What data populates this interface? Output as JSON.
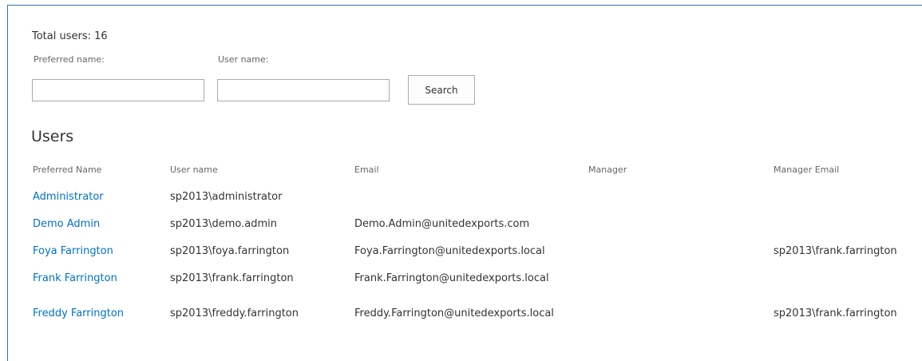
{
  "summary": {
    "total_users": "Total users: 16"
  },
  "filters": {
    "preferred_name_label": "Preferred name:",
    "preferred_name_value": "",
    "user_name_label": "User name:",
    "user_name_value": "",
    "search_label": "Search"
  },
  "section": {
    "title": "Users"
  },
  "table": {
    "columns": [
      "Preferred Name",
      "User name",
      "Email",
      "Manager",
      "Manager Email"
    ],
    "rows": [
      {
        "name": "Administrator",
        "user": "sp2013\\administrator",
        "email": "",
        "manager": "",
        "manager_email": ""
      },
      {
        "name": "Demo Admin",
        "user": "sp2013\\demo.admin",
        "email": "Demo.Admin@unitedexports.com",
        "manager": "",
        "manager_email": ""
      },
      {
        "name": "Foya Farrington",
        "user": "sp2013\\foya.farrington",
        "email": "Foya.Farrington@unitedexports.local",
        "manager": "",
        "manager_email": "sp2013\\frank.farrington"
      },
      {
        "name": "Frank Farrington",
        "user": "sp2013\\frank.farrington",
        "email": "Frank.Farrington@unitedexports.local",
        "manager": "",
        "manager_email": ""
      },
      {
        "name": "Freddy Farrington",
        "user": "sp2013\\freddy.farrington",
        "email": "Freddy.Farrington@unitedexports.local",
        "manager": "",
        "manager_email": "sp2013\\frank.farrington"
      }
    ]
  },
  "colors": {
    "link": "#0072c6",
    "frame_border": "#2e74b5"
  }
}
